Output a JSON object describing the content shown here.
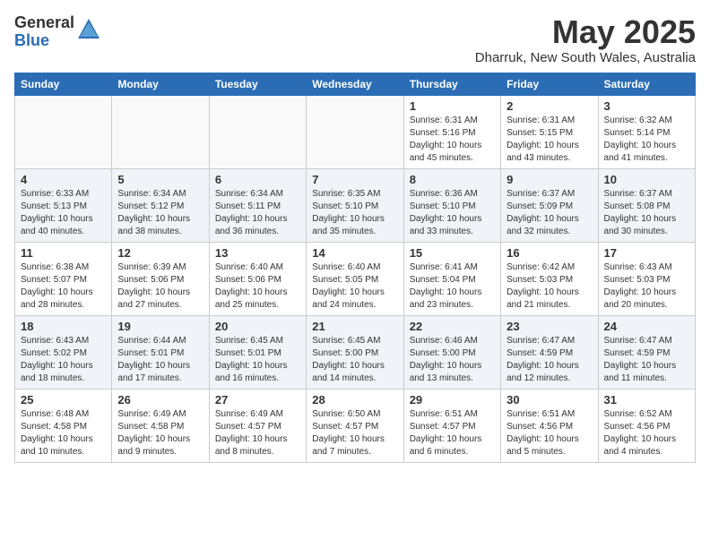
{
  "logo": {
    "general": "General",
    "blue": "Blue"
  },
  "title": "May 2025",
  "location": "Dharruk, New South Wales, Australia",
  "days_of_week": [
    "Sunday",
    "Monday",
    "Tuesday",
    "Wednesday",
    "Thursday",
    "Friday",
    "Saturday"
  ],
  "weeks": [
    [
      {
        "day": "",
        "info": ""
      },
      {
        "day": "",
        "info": ""
      },
      {
        "day": "",
        "info": ""
      },
      {
        "day": "",
        "info": ""
      },
      {
        "day": "1",
        "info": "Sunrise: 6:31 AM\nSunset: 5:16 PM\nDaylight: 10 hours\nand 45 minutes."
      },
      {
        "day": "2",
        "info": "Sunrise: 6:31 AM\nSunset: 5:15 PM\nDaylight: 10 hours\nand 43 minutes."
      },
      {
        "day": "3",
        "info": "Sunrise: 6:32 AM\nSunset: 5:14 PM\nDaylight: 10 hours\nand 41 minutes."
      }
    ],
    [
      {
        "day": "4",
        "info": "Sunrise: 6:33 AM\nSunset: 5:13 PM\nDaylight: 10 hours\nand 40 minutes."
      },
      {
        "day": "5",
        "info": "Sunrise: 6:34 AM\nSunset: 5:12 PM\nDaylight: 10 hours\nand 38 minutes."
      },
      {
        "day": "6",
        "info": "Sunrise: 6:34 AM\nSunset: 5:11 PM\nDaylight: 10 hours\nand 36 minutes."
      },
      {
        "day": "7",
        "info": "Sunrise: 6:35 AM\nSunset: 5:10 PM\nDaylight: 10 hours\nand 35 minutes."
      },
      {
        "day": "8",
        "info": "Sunrise: 6:36 AM\nSunset: 5:10 PM\nDaylight: 10 hours\nand 33 minutes."
      },
      {
        "day": "9",
        "info": "Sunrise: 6:37 AM\nSunset: 5:09 PM\nDaylight: 10 hours\nand 32 minutes."
      },
      {
        "day": "10",
        "info": "Sunrise: 6:37 AM\nSunset: 5:08 PM\nDaylight: 10 hours\nand 30 minutes."
      }
    ],
    [
      {
        "day": "11",
        "info": "Sunrise: 6:38 AM\nSunset: 5:07 PM\nDaylight: 10 hours\nand 28 minutes."
      },
      {
        "day": "12",
        "info": "Sunrise: 6:39 AM\nSunset: 5:06 PM\nDaylight: 10 hours\nand 27 minutes."
      },
      {
        "day": "13",
        "info": "Sunrise: 6:40 AM\nSunset: 5:06 PM\nDaylight: 10 hours\nand 25 minutes."
      },
      {
        "day": "14",
        "info": "Sunrise: 6:40 AM\nSunset: 5:05 PM\nDaylight: 10 hours\nand 24 minutes."
      },
      {
        "day": "15",
        "info": "Sunrise: 6:41 AM\nSunset: 5:04 PM\nDaylight: 10 hours\nand 23 minutes."
      },
      {
        "day": "16",
        "info": "Sunrise: 6:42 AM\nSunset: 5:03 PM\nDaylight: 10 hours\nand 21 minutes."
      },
      {
        "day": "17",
        "info": "Sunrise: 6:43 AM\nSunset: 5:03 PM\nDaylight: 10 hours\nand 20 minutes."
      }
    ],
    [
      {
        "day": "18",
        "info": "Sunrise: 6:43 AM\nSunset: 5:02 PM\nDaylight: 10 hours\nand 18 minutes."
      },
      {
        "day": "19",
        "info": "Sunrise: 6:44 AM\nSunset: 5:01 PM\nDaylight: 10 hours\nand 17 minutes."
      },
      {
        "day": "20",
        "info": "Sunrise: 6:45 AM\nSunset: 5:01 PM\nDaylight: 10 hours\nand 16 minutes."
      },
      {
        "day": "21",
        "info": "Sunrise: 6:45 AM\nSunset: 5:00 PM\nDaylight: 10 hours\nand 14 minutes."
      },
      {
        "day": "22",
        "info": "Sunrise: 6:46 AM\nSunset: 5:00 PM\nDaylight: 10 hours\nand 13 minutes."
      },
      {
        "day": "23",
        "info": "Sunrise: 6:47 AM\nSunset: 4:59 PM\nDaylight: 10 hours\nand 12 minutes."
      },
      {
        "day": "24",
        "info": "Sunrise: 6:47 AM\nSunset: 4:59 PM\nDaylight: 10 hours\nand 11 minutes."
      }
    ],
    [
      {
        "day": "25",
        "info": "Sunrise: 6:48 AM\nSunset: 4:58 PM\nDaylight: 10 hours\nand 10 minutes."
      },
      {
        "day": "26",
        "info": "Sunrise: 6:49 AM\nSunset: 4:58 PM\nDaylight: 10 hours\nand 9 minutes."
      },
      {
        "day": "27",
        "info": "Sunrise: 6:49 AM\nSunset: 4:57 PM\nDaylight: 10 hours\nand 8 minutes."
      },
      {
        "day": "28",
        "info": "Sunrise: 6:50 AM\nSunset: 4:57 PM\nDaylight: 10 hours\nand 7 minutes."
      },
      {
        "day": "29",
        "info": "Sunrise: 6:51 AM\nSunset: 4:57 PM\nDaylight: 10 hours\nand 6 minutes."
      },
      {
        "day": "30",
        "info": "Sunrise: 6:51 AM\nSunset: 4:56 PM\nDaylight: 10 hours\nand 5 minutes."
      },
      {
        "day": "31",
        "info": "Sunrise: 6:52 AM\nSunset: 4:56 PM\nDaylight: 10 hours\nand 4 minutes."
      }
    ]
  ]
}
